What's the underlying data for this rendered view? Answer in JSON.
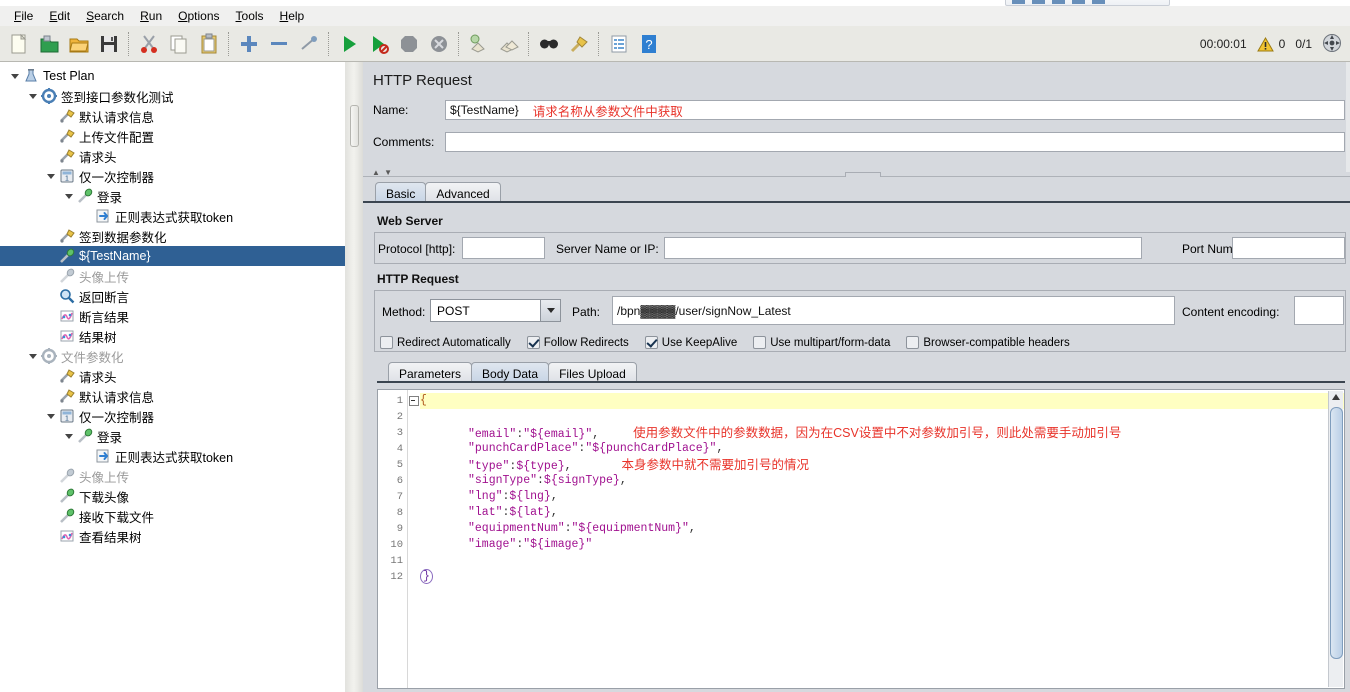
{
  "menu": {
    "items": [
      "File",
      "Edit",
      "Search",
      "Run",
      "Options",
      "Tools",
      "Help"
    ]
  },
  "toolbar": {
    "icons": [
      "new-file-icon",
      "open-template-icon",
      "open-folder-icon",
      "save-icon",
      "cut-icon",
      "copy-icon",
      "paste-icon",
      "expand-icon",
      "collapse-icon",
      "toggle-icon",
      "start-icon",
      "start-no-pauses-icon",
      "stop-icon",
      "shutdown-icon",
      "clear-icon",
      "clear-all-icon",
      "search-icon",
      "search-reset-icon",
      "function-helper-icon",
      "help-icon"
    ],
    "elapsed_time": "00:00:01",
    "warning_count": "0",
    "thread_counter": "0/1",
    "expand_icon": "expand-all-icon"
  },
  "tree": {
    "nodes": [
      {
        "label": "Test Plan",
        "depth": 0,
        "icon": "test-plan-icon",
        "toggle": "open",
        "state": "normal"
      },
      {
        "label": "签到接口参数化测试",
        "depth": 1,
        "icon": "thread-group-icon",
        "toggle": "open",
        "state": "normal"
      },
      {
        "label": "默认请求信息",
        "depth": 2,
        "icon": "config-icon",
        "toggle": "none",
        "state": "normal"
      },
      {
        "label": "上传文件配置",
        "depth": 2,
        "icon": "config-icon",
        "toggle": "none",
        "state": "normal"
      },
      {
        "label": "请求头",
        "depth": 2,
        "icon": "config-icon",
        "toggle": "none",
        "state": "normal"
      },
      {
        "label": "仅一次控制器",
        "depth": 2,
        "icon": "controller-icon",
        "toggle": "open",
        "state": "normal"
      },
      {
        "label": "登录",
        "depth": 3,
        "icon": "sampler-icon",
        "toggle": "open",
        "state": "normal"
      },
      {
        "label": "正则表达式获取token",
        "depth": 4,
        "icon": "extractor-icon",
        "toggle": "none",
        "state": "normal"
      },
      {
        "label": "签到数据参数化",
        "depth": 2,
        "icon": "config-icon",
        "toggle": "none",
        "state": "normal"
      },
      {
        "label": "${TestName}",
        "depth": 2,
        "icon": "sampler-icon",
        "toggle": "none",
        "state": "selected"
      },
      {
        "label": "头像上传",
        "depth": 2,
        "icon": "sampler-gray-icon",
        "toggle": "none",
        "state": "disabled"
      },
      {
        "label": "返回断言",
        "depth": 2,
        "icon": "assertion-icon",
        "toggle": "none",
        "state": "normal"
      },
      {
        "label": "断言结果",
        "depth": 2,
        "icon": "listener-icon",
        "toggle": "none",
        "state": "normal"
      },
      {
        "label": "结果树",
        "depth": 2,
        "icon": "listener-icon",
        "toggle": "none",
        "state": "normal"
      },
      {
        "label": "文件参数化",
        "depth": 1,
        "icon": "thread-group-gray-icon",
        "toggle": "open",
        "state": "disabled"
      },
      {
        "label": "请求头",
        "depth": 2,
        "icon": "config-icon",
        "toggle": "none",
        "state": "normal"
      },
      {
        "label": "默认请求信息",
        "depth": 2,
        "icon": "config-icon",
        "toggle": "none",
        "state": "normal"
      },
      {
        "label": "仅一次控制器",
        "depth": 2,
        "icon": "controller-icon",
        "toggle": "open",
        "state": "normal"
      },
      {
        "label": "登录",
        "depth": 3,
        "icon": "sampler-icon",
        "toggle": "open",
        "state": "normal"
      },
      {
        "label": "正则表达式获取token",
        "depth": 4,
        "icon": "extractor-icon",
        "toggle": "none",
        "state": "normal"
      },
      {
        "label": "头像上传",
        "depth": 2,
        "icon": "sampler-gray-icon",
        "toggle": "none",
        "state": "disabled"
      },
      {
        "label": "下载头像",
        "depth": 2,
        "icon": "sampler-icon",
        "toggle": "none",
        "state": "normal"
      },
      {
        "label": "接收下载文件",
        "depth": 2,
        "icon": "sampler-icon",
        "toggle": "none",
        "state": "normal"
      },
      {
        "label": "查看结果树",
        "depth": 2,
        "icon": "listener-icon",
        "toggle": "none",
        "state": "normal"
      }
    ]
  },
  "panel": {
    "title": "HTTP Request",
    "name_label": "Name:",
    "name_value": "${TestName}",
    "name_annotation": "请求名称从参数文件中获取",
    "comments_label": "Comments:",
    "comments_value": "",
    "tabs": [
      {
        "label": "Basic",
        "active": true
      },
      {
        "label": "Advanced",
        "active": false
      }
    ],
    "web_server": {
      "title": "Web Server",
      "protocol_label": "Protocol [http]:",
      "protocol_value": "",
      "server_label": "Server Name or IP:",
      "server_value": "",
      "port_label": "Port Number:",
      "port_value": ""
    },
    "http_request": {
      "title": "HTTP Request",
      "method_label": "Method:",
      "method_value": "POST",
      "path_label": "Path:",
      "path_value": "/bpn▓▓▓▓/user/signNow_Latest",
      "content_encoding_label": "Content encoding:",
      "content_encoding_value": "",
      "checkboxes": [
        {
          "label": "Redirect Automatically",
          "checked": false
        },
        {
          "label": "Follow Redirects",
          "checked": true
        },
        {
          "label": "Use KeepAlive",
          "checked": true
        },
        {
          "label": "Use multipart/form-data",
          "checked": false
        },
        {
          "label": "Browser-compatible headers",
          "checked": false
        }
      ]
    },
    "body_tabs": [
      {
        "label": "Parameters",
        "active": false
      },
      {
        "label": "Body Data",
        "active": true
      },
      {
        "label": "Files Upload",
        "active": false
      }
    ]
  },
  "editor": {
    "line_numbers": [
      "1",
      "2",
      "3",
      "4",
      "5",
      "6",
      "7",
      "8",
      "9",
      "10",
      "11",
      "12"
    ],
    "lines": [
      {
        "n": 1,
        "text": "{",
        "type": "brace",
        "highlight": true,
        "fold": true
      },
      {
        "n": 2,
        "text": "",
        "type": "blank"
      },
      {
        "n": 3,
        "key": "\"email\"",
        "sep": ":",
        "val": "\"${email}\"",
        "tail": ",",
        "type": "pair",
        "annotation": "使用参数文件中的参数数据，因为在CSV设置中不对参数加引号，则此处需要手动加引号"
      },
      {
        "n": 4,
        "key": "\"punchCardPlace\"",
        "sep": ":",
        "val": "\"${punchCardPlace}\"",
        "tail": ",",
        "type": "pair"
      },
      {
        "n": 5,
        "key": "\"type\"",
        "sep": ":",
        "val": "${type}",
        "tail": ",",
        "type": "pair",
        "annotation": "本身参数中就不需要加引号的情况"
      },
      {
        "n": 6,
        "key": "\"signType\"",
        "sep": ":",
        "val": "${signType}",
        "tail": ",",
        "type": "pair"
      },
      {
        "n": 7,
        "key": "\"lng\"",
        "sep": ":",
        "val": "${lng}",
        "tail": ",",
        "type": "pair"
      },
      {
        "n": 8,
        "key": "\"lat\"",
        "sep": ":",
        "val": "${lat}",
        "tail": ",",
        "type": "pair"
      },
      {
        "n": 9,
        "key": "\"equipmentNum\"",
        "sep": ":",
        "val": "\"${equipmentNum}\"",
        "tail": ",",
        "type": "pair"
      },
      {
        "n": 10,
        "key": "\"image\"",
        "sep": ":",
        "val": "\"${image}\"",
        "tail": "",
        "type": "pair"
      },
      {
        "n": 11,
        "text": "",
        "type": "blank"
      },
      {
        "n": 12,
        "text": "}",
        "type": "endbrace"
      }
    ]
  },
  "colors": {
    "selection": "#2f6094",
    "annotation_red": "#e8332a",
    "json_key": "#a0108f",
    "brace": "#b05a1e",
    "highlight_line": "#ffffc2",
    "panel_bg": "#d6d9de"
  }
}
